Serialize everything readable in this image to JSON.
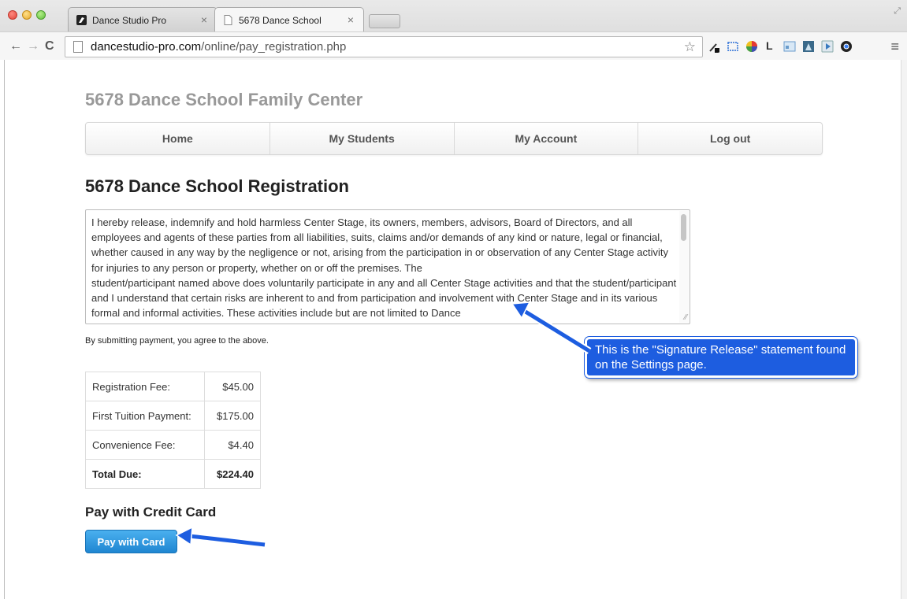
{
  "browser": {
    "tabs": [
      {
        "title": "Dance Studio Pro",
        "active": false
      },
      {
        "title": "5678 Dance School",
        "active": true
      }
    ],
    "close_glyph": "×",
    "url_host": "dancestudio-pro.com",
    "url_path": "/online/pay_registration.php",
    "icons": [
      "back-icon",
      "forward-icon",
      "reload-icon",
      "page-icon",
      "bookmark-star-icon",
      "eyedropper-icon",
      "screenshot-icon",
      "color-wheel-icon",
      "extension-l-icon",
      "extension-window-icon",
      "extension-app-icon",
      "play-icon",
      "chrome-icon",
      "menu-icon"
    ],
    "ext_letter": "L"
  },
  "site": {
    "title": "5678 Dance School Family Center"
  },
  "nav": {
    "items": [
      {
        "label": "Home"
      },
      {
        "label": "My Students"
      },
      {
        "label": "My Account"
      },
      {
        "label": "Log out"
      }
    ]
  },
  "page": {
    "heading": "5678 Dance School Registration",
    "release_text": "I hereby release, indemnify and hold harmless Center Stage, its owners, members, advisors, Board of Directors, and all employees and agents of these parties from all liabilities, suits, claims and/or demands of any kind or nature, legal or financial, whether caused in any way by the negligence or not, arising from the participation in or observation of any Center Stage activity for injuries to any person or property, whether on or off the premises. The\nstudent/participant named above does voluntarily participate in any and all Center Stage activities and that the student/participant and I understand that certain risks are inherent to and from participation and involvement with Center Stage and in its various formal and informal activities. These activities include but are not limited to Dance",
    "agree_note": "By submitting payment, you agree to the above.",
    "fees": [
      {
        "label": "Registration Fee:",
        "amount": "$45.00"
      },
      {
        "label": "First Tuition Payment:",
        "amount": "$175.00"
      },
      {
        "label": "Convenience Fee:",
        "amount": "$4.40"
      },
      {
        "label": "Total Due:",
        "amount": "$224.40"
      }
    ],
    "pay_heading": "Pay with Credit Card",
    "pay_button": "Pay with Card"
  },
  "annotation": {
    "callout_text": "This is the \"Signature Release\" statement found on the Settings page.",
    "color": "#1d5de0"
  },
  "colors": {
    "button_blue": "#2a93dc",
    "site_title_gray": "#999999"
  }
}
